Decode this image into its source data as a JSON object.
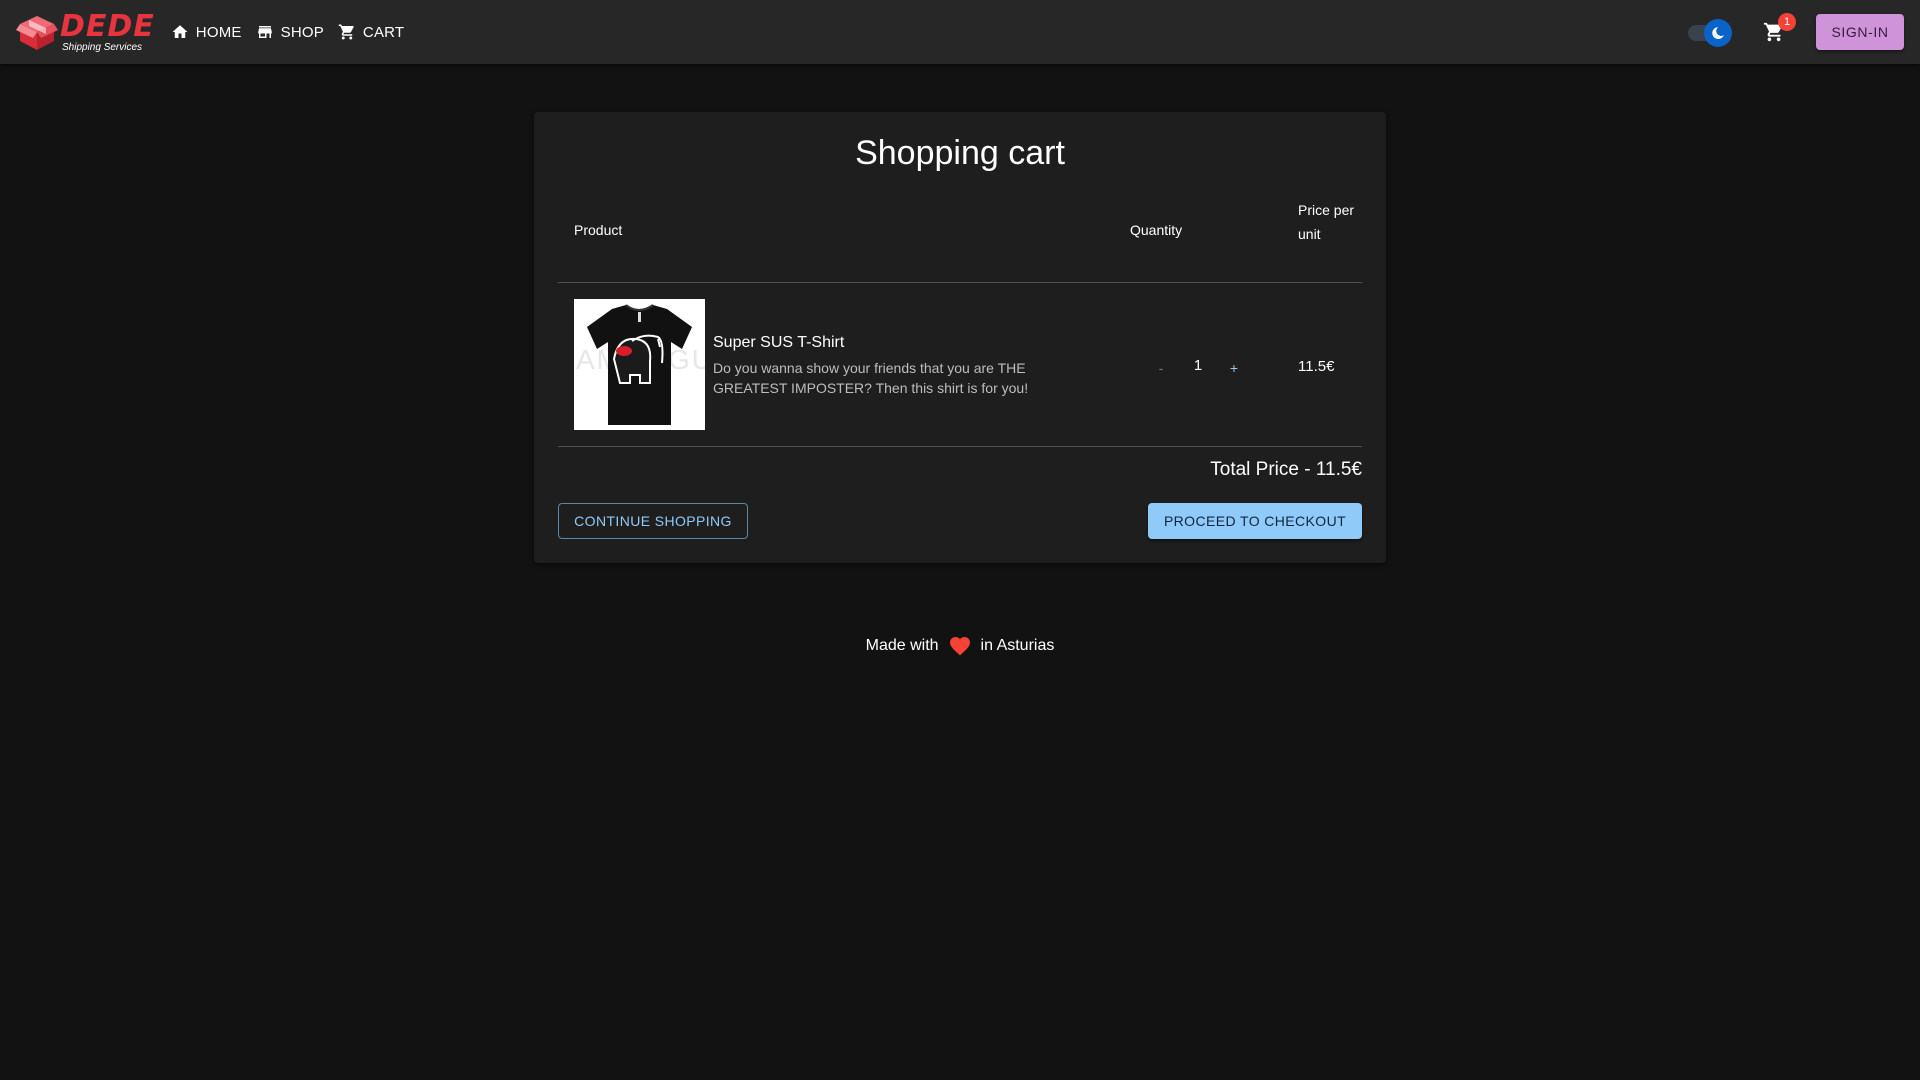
{
  "header": {
    "logo": {
      "title": "DEDE",
      "subtitle": "Shipping Services",
      "color": "#e8343f"
    },
    "nav": [
      {
        "label": "HOME",
        "icon": "home-icon"
      },
      {
        "label": "SHOP",
        "icon": "store-icon"
      },
      {
        "label": "CART",
        "icon": "cart-icon"
      }
    ],
    "theme_toggle": {
      "mode": "dark",
      "icon": "moon-icon"
    },
    "cart": {
      "icon": "cart-icon",
      "badge_count": "1"
    },
    "signin_label": "SIGN-IN"
  },
  "cart": {
    "title": "Shopping cart",
    "columns": {
      "product": "Product",
      "quantity": "Quantity",
      "price": "Price per unit"
    },
    "items": [
      {
        "name": "Super SUS T-Shirt",
        "description": "Do you wanna show your friends that you are THE GREATEST IMPOSTER? Then this shirt is for you!",
        "image": "black t-shirt with impostor graphic",
        "quantity": "1",
        "minus_label": "-",
        "plus_label": "+",
        "unit_price": "11.5€"
      }
    ],
    "total_label": "Total Price - 11.5€",
    "continue_label": "CONTINUE SHOPPING",
    "checkout_label": "PROCEED TO CHECKOUT"
  },
  "footer": {
    "prefix": "Made with",
    "icon": "heart-icon",
    "suffix": "in Asturias"
  },
  "colors": {
    "background": "#121212",
    "appbar": "#272727",
    "card": "#1e1e1e",
    "primary": "#90caf9",
    "secondary": "#ce93d8",
    "badge": "#f44336"
  }
}
